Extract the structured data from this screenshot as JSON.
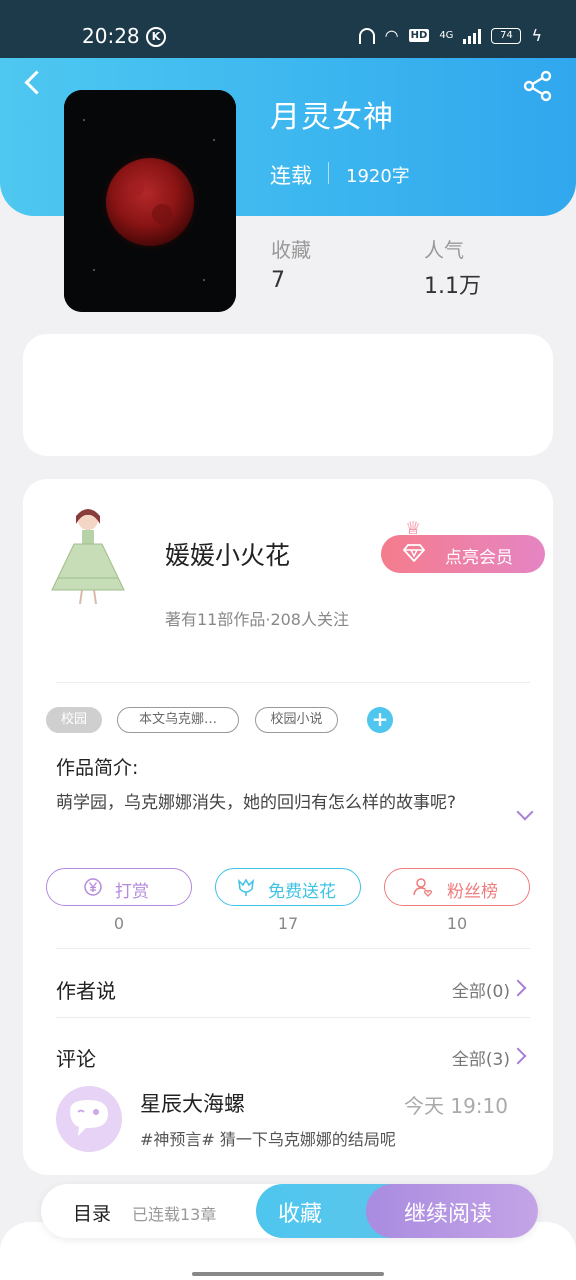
{
  "status_bar": {
    "time": "20:28",
    "k_badge": "K",
    "hd": "HD",
    "network": "4G",
    "battery": "74"
  },
  "book": {
    "title": "月灵女神",
    "status": "连载",
    "word_count": "1920字"
  },
  "stats": {
    "favorites_label": "收藏",
    "favorites_value": "7",
    "popularity_label": "人气",
    "popularity_value": "1.1万"
  },
  "author": {
    "name": "媛媛小火花",
    "meta": "著有11部作品·208人关注",
    "vip_label": "点亮会员"
  },
  "tags": [
    "校园",
    "本文乌克娜…",
    "校园小说"
  ],
  "intro": {
    "title": "作品简介:",
    "text": "萌学园，乌克娜娜消失，她的回归有怎么样的故事呢?"
  },
  "actions": [
    {
      "label": "打赏",
      "count": "0",
      "icon": "yen-coin-icon"
    },
    {
      "label": "免费送花",
      "count": "17",
      "icon": "flower-icon"
    },
    {
      "label": "粉丝榜",
      "count": "10",
      "icon": "fan-user-icon"
    }
  ],
  "author_says": {
    "title": "作者说",
    "more": "全部(0)"
  },
  "comments": {
    "title": "评论",
    "more": "全部(3)",
    "items": [
      {
        "user": "星辰大海螺",
        "time": "今天 19:10",
        "text": "#神预言# 猜一下乌克娜娜的结局呢"
      }
    ]
  },
  "bottom_bar": {
    "toc": "目录",
    "serial": "已连载13章",
    "collect": "收藏",
    "read": "继续阅读"
  },
  "colors": {
    "accent_blue": "#3cb6ef",
    "accent_purple": "#a67fd8",
    "vip_pink": "#f57c8c",
    "reward_purple": "#b48adf",
    "flower_cyan": "#3fc3e4",
    "fans_red": "#ef7c7c"
  }
}
